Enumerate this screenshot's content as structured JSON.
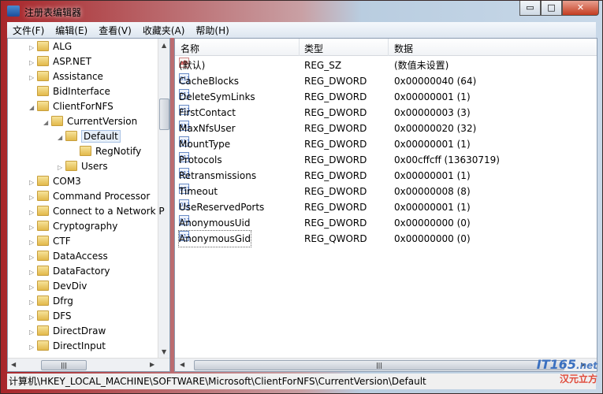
{
  "window": {
    "title": "注册表编辑器",
    "minimize": "▭",
    "maximize": "□",
    "close": "✕"
  },
  "menu": [
    "文件(F)",
    "编辑(E)",
    "查看(V)",
    "收藏夹(A)",
    "帮助(H)"
  ],
  "tree": [
    {
      "label": "ALG",
      "level": 1,
      "expander": "▷"
    },
    {
      "label": "ASP.NET",
      "level": 1,
      "expander": "▷"
    },
    {
      "label": "Assistance",
      "level": 1,
      "expander": "▷"
    },
    {
      "label": "BidInterface",
      "level": 1,
      "expander": ""
    },
    {
      "label": "ClientForNFS",
      "level": 1,
      "expander": "◢"
    },
    {
      "label": "CurrentVersion",
      "level": 2,
      "expander": "◢"
    },
    {
      "label": "Default",
      "level": 3,
      "expander": "◢",
      "selected": true
    },
    {
      "label": "RegNotify",
      "level": 4,
      "expander": ""
    },
    {
      "label": "Users",
      "level": 3,
      "expander": "▷"
    },
    {
      "label": "COM3",
      "level": 1,
      "expander": "▷"
    },
    {
      "label": "Command Processor",
      "level": 1,
      "expander": "▷"
    },
    {
      "label": "Connect to a Network P",
      "level": 1,
      "expander": "▷"
    },
    {
      "label": "Cryptography",
      "level": 1,
      "expander": "▷"
    },
    {
      "label": "CTF",
      "level": 1,
      "expander": "▷"
    },
    {
      "label": "DataAccess",
      "level": 1,
      "expander": "▷"
    },
    {
      "label": "DataFactory",
      "level": 1,
      "expander": "▷"
    },
    {
      "label": "DevDiv",
      "level": 1,
      "expander": "▷"
    },
    {
      "label": "Dfrg",
      "level": 1,
      "expander": "▷"
    },
    {
      "label": "DFS",
      "level": 1,
      "expander": "▷"
    },
    {
      "label": "DirectDraw",
      "level": 1,
      "expander": "▷"
    },
    {
      "label": "DirectInput",
      "level": 1,
      "expander": "▷"
    }
  ],
  "columns": {
    "name": "名称",
    "type": "类型",
    "data": "数据"
  },
  "values": [
    {
      "icon": "ab",
      "name": "(默认)",
      "type": "REG_SZ",
      "data": "(数值未设置)"
    },
    {
      "icon": "011",
      "name": "CacheBlocks",
      "type": "REG_DWORD",
      "data": "0x00000040 (64)"
    },
    {
      "icon": "011",
      "name": "DeleteSymLinks",
      "type": "REG_DWORD",
      "data": "0x00000001 (1)"
    },
    {
      "icon": "011",
      "name": "FirstContact",
      "type": "REG_DWORD",
      "data": "0x00000003 (3)"
    },
    {
      "icon": "011",
      "name": "MaxNfsUser",
      "type": "REG_DWORD",
      "data": "0x00000020 (32)"
    },
    {
      "icon": "011",
      "name": "MountType",
      "type": "REG_DWORD",
      "data": "0x00000001 (1)"
    },
    {
      "icon": "011",
      "name": "Protocols",
      "type": "REG_DWORD",
      "data": "0x00cffcff (13630719)"
    },
    {
      "icon": "011",
      "name": "Retransmissions",
      "type": "REG_DWORD",
      "data": "0x00000001 (1)"
    },
    {
      "icon": "011",
      "name": "Timeout",
      "type": "REG_DWORD",
      "data": "0x00000008 (8)"
    },
    {
      "icon": "011",
      "name": "UseReservedPorts",
      "type": "REG_DWORD",
      "data": "0x00000001 (1)"
    },
    {
      "icon": "011",
      "name": "AnonymousUid",
      "type": "REG_DWORD",
      "data": "0x00000000 (0)"
    },
    {
      "icon": "011",
      "name": "AnonymousGid",
      "type": "REG_QWORD",
      "data": "0x00000000 (0)",
      "focused": true
    }
  ],
  "status": "计算机\\HKEY_LOCAL_MACHINE\\SOFTWARE\\Microsoft\\ClientForNFS\\CurrentVersion\\Default",
  "watermark": {
    "brand": "IT165",
    "suffix": ".net",
    "sub": "汉元立方"
  }
}
